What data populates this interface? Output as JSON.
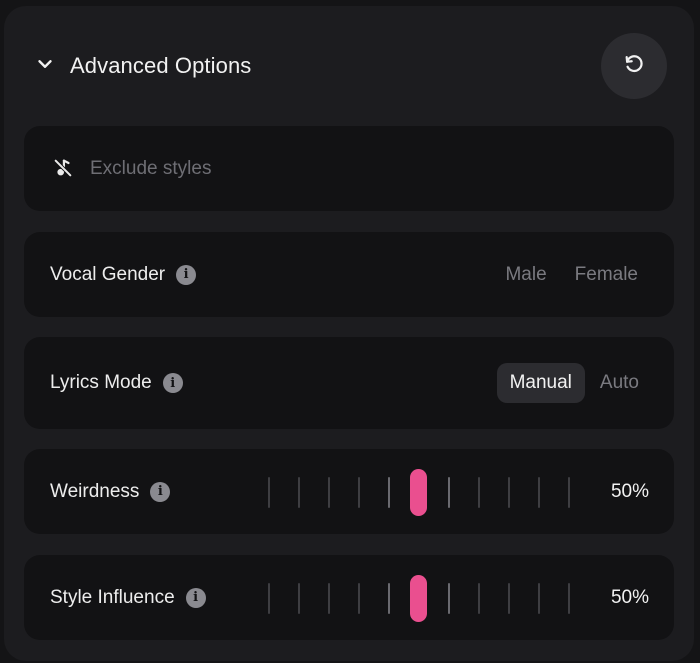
{
  "header": {
    "title": "Advanced Options",
    "collapse_icon": "chevron-down-icon",
    "reset_icon": "rotate-ccw-icon"
  },
  "exclude_styles": {
    "placeholder": "Exclude styles",
    "value": "",
    "icon": "music-note-off-icon"
  },
  "vocal_gender": {
    "label": "Vocal Gender",
    "options": [
      "Male",
      "Female"
    ],
    "selected": null
  },
  "lyrics_mode": {
    "label": "Lyrics Mode",
    "options": [
      "Manual",
      "Auto"
    ],
    "selected": "Manual"
  },
  "weirdness": {
    "label": "Weirdness",
    "value_text": "50%",
    "value": 0.5
  },
  "style_influence": {
    "label": "Style Influence",
    "value_text": "50%",
    "value": 0.5
  },
  "colors": {
    "accent": "#ea4f8f",
    "card": "#121214",
    "panel": "#1c1c1f"
  }
}
